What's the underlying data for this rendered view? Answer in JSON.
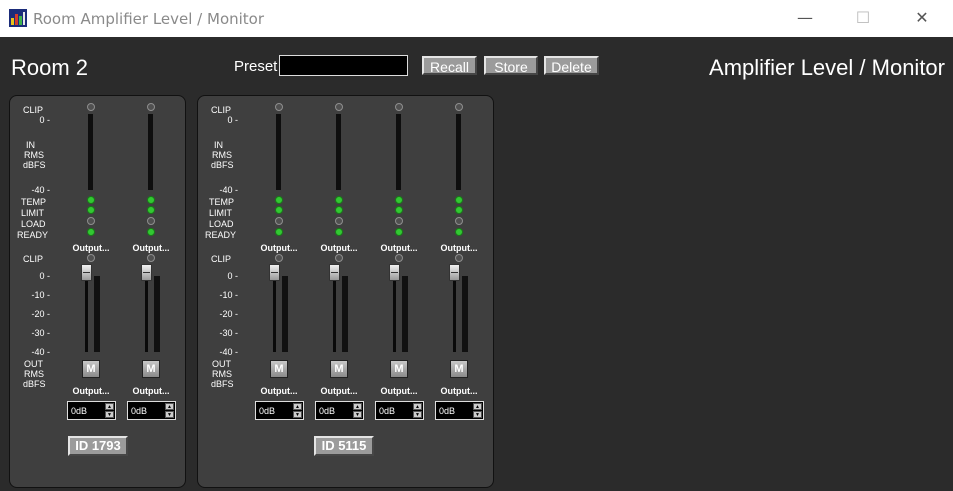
{
  "window": {
    "title": "Room Amplifier Level / Monitor",
    "minimize_glyph": "—",
    "maximize_glyph": "☐",
    "close_glyph": "✕",
    "icon": "app-icon"
  },
  "header": {
    "room_name": "Room 2",
    "page_heading": "Amplifier Level / Monitor",
    "preset_label": "Preset",
    "preset_value": "",
    "recall_label": "Recall",
    "store_label": "Store",
    "delete_label": "Delete"
  },
  "labels": {
    "clip": "CLIP",
    "in": "IN",
    "rms": "RMS",
    "dbfs": "dBFS",
    "temp": "TEMP",
    "limit": "LIMIT",
    "load": "LOAD",
    "ready": "READY",
    "out": "OUT",
    "mute": "M",
    "in_scale_top": "0 -",
    "in_scale_bottom": "-40 -",
    "out_scale": [
      "0 -",
      "-10 -",
      "-20 -",
      "-30 -",
      "-40 -"
    ]
  },
  "colors": {
    "background": "#2b2b2b",
    "panel": "#3f3f3f",
    "led_on": "#32c832",
    "led_off": "#505050"
  },
  "amplifiers": [
    {
      "id_label": "ID 1793",
      "channels": [
        {
          "input_name": "Output...",
          "output_name": "Output...",
          "gain": "0dB",
          "fader_level_db": 0,
          "temp": true,
          "limit": true,
          "load": false,
          "ready": true,
          "clip_in": false,
          "clip_out": false
        },
        {
          "input_name": "Output...",
          "output_name": "Output...",
          "gain": "0dB",
          "fader_level_db": 0,
          "temp": true,
          "limit": true,
          "load": false,
          "ready": true,
          "clip_in": false,
          "clip_out": false
        }
      ]
    },
    {
      "id_label": "ID 5115",
      "channels": [
        {
          "input_name": "Output...",
          "output_name": "Output...",
          "gain": "0dB",
          "fader_level_db": 0,
          "temp": true,
          "limit": true,
          "load": false,
          "ready": true,
          "clip_in": false,
          "clip_out": false
        },
        {
          "input_name": "Output...",
          "output_name": "Output...",
          "gain": "0dB",
          "fader_level_db": 0,
          "temp": true,
          "limit": true,
          "load": false,
          "ready": true,
          "clip_in": false,
          "clip_out": false
        },
        {
          "input_name": "Output...",
          "output_name": "Output...",
          "gain": "0dB",
          "fader_level_db": 0,
          "temp": true,
          "limit": true,
          "load": false,
          "ready": true,
          "clip_in": false,
          "clip_out": false
        },
        {
          "input_name": "Output...",
          "output_name": "Output...",
          "gain": "0dB",
          "fader_level_db": 0,
          "temp": true,
          "limit": true,
          "load": false,
          "ready": true,
          "clip_in": false,
          "clip_out": false
        }
      ]
    }
  ]
}
